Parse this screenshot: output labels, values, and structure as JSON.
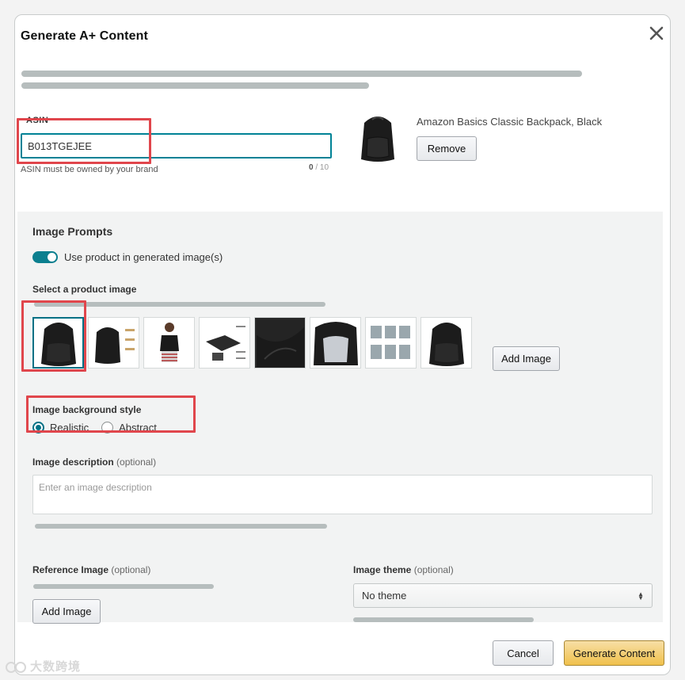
{
  "modal": {
    "title": "Generate A+ Content"
  },
  "asin": {
    "label": "ASIN",
    "value": "B013TGEJEE",
    "hint": "ASIN must be owned by your brand",
    "count_current": "0",
    "count_sep": " / ",
    "count_max": "10"
  },
  "product": {
    "title": "Amazon Basics Classic Backpack, Black",
    "remove_label": "Remove"
  },
  "prompts": {
    "title": "Image Prompts",
    "use_product_label": "Use product in generated image(s)",
    "select_image_label": "Select a product image",
    "add_image_label": "Add Image",
    "background_label": "Image background style",
    "style_options": [
      "Realistic",
      "Abstract"
    ],
    "style_selected": "Realistic",
    "description_label": "Image description",
    "description_optional": "(optional)",
    "description_placeholder": "Enter an image description",
    "reference_label": "Reference Image",
    "reference_optional": "(optional)",
    "reference_add_label": "Add Image",
    "theme_label": "Image theme",
    "theme_optional": "(optional)",
    "theme_value": "No theme"
  },
  "footer": {
    "cancel_label": "Cancel",
    "generate_label": "Generate Content"
  },
  "watermark": {
    "text": "大数跨境"
  },
  "colors": {
    "accent": "#007185",
    "toggle": "#0c7f8f",
    "primary_button": "#f0c14b",
    "highlight": "#e0464c"
  }
}
